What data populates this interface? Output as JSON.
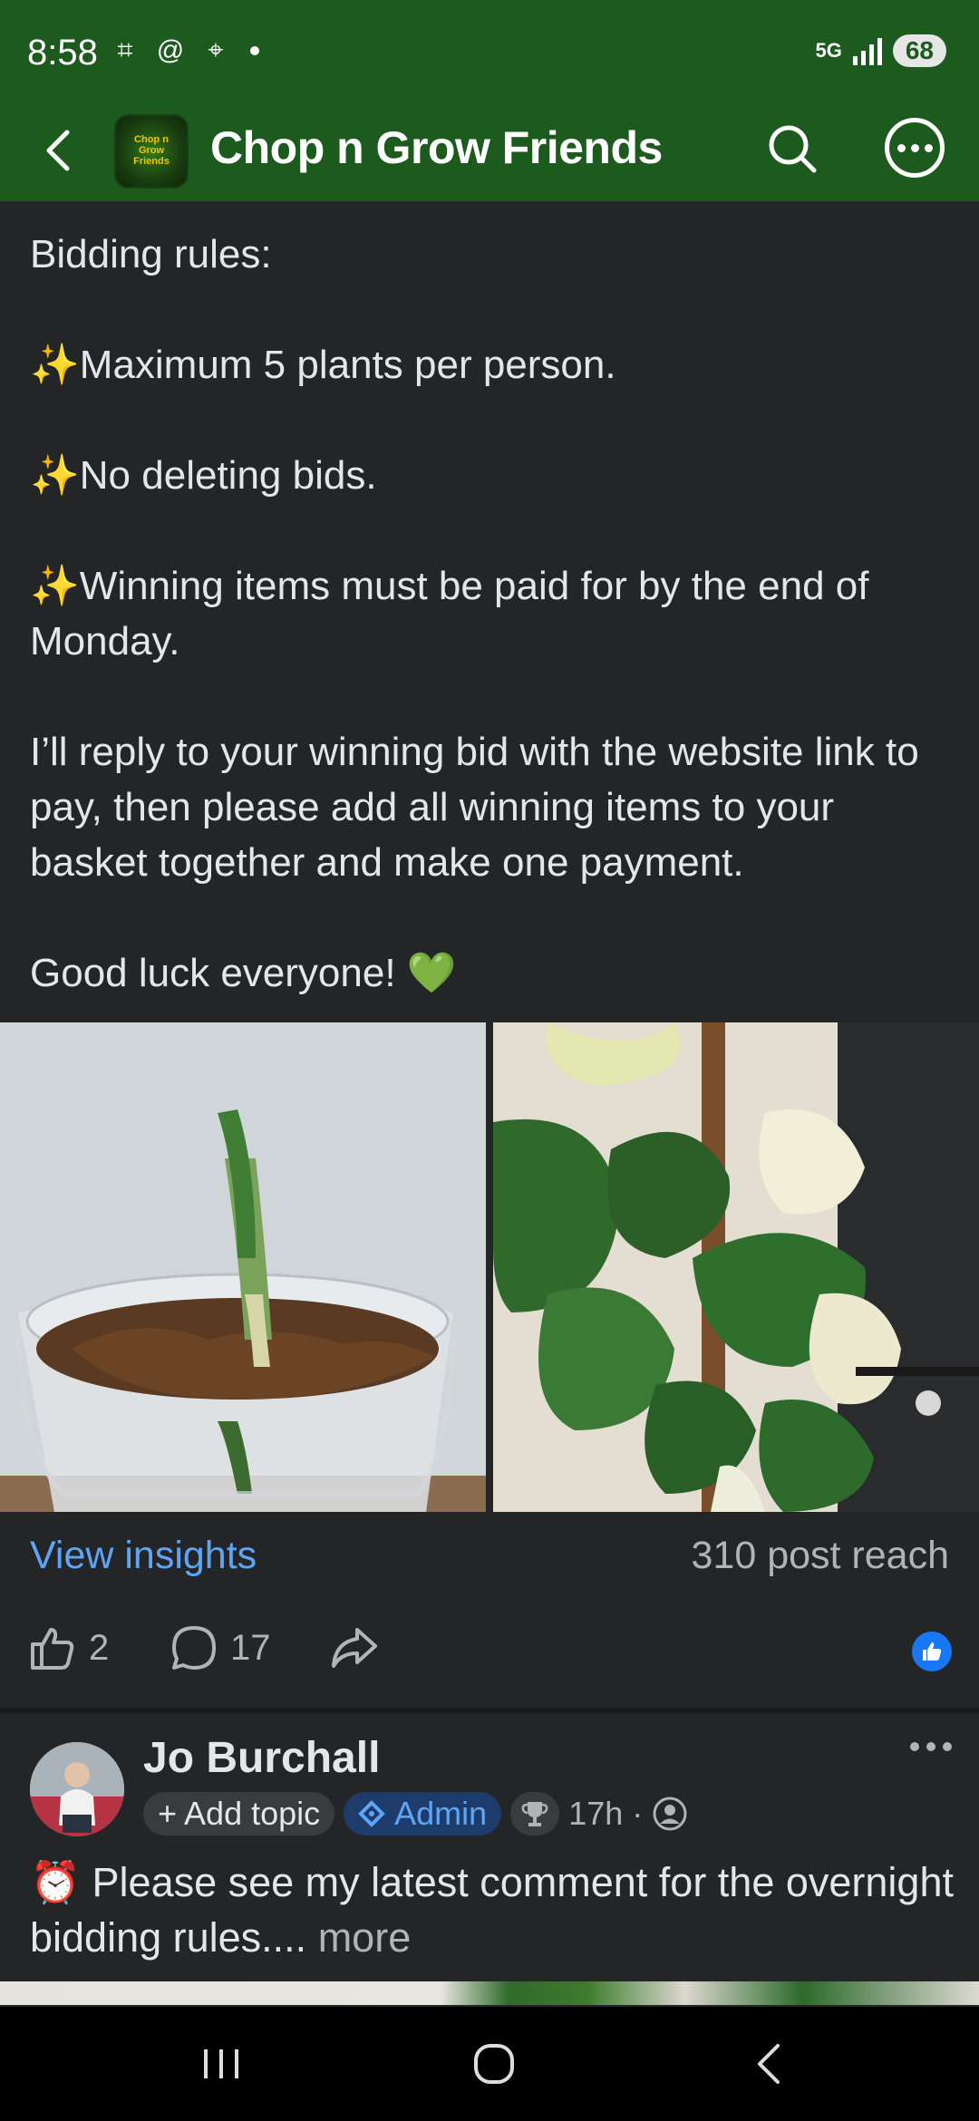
{
  "status": {
    "time": "8:58",
    "network": "5G",
    "battery": "68"
  },
  "header": {
    "title": "Chop n Grow Friends",
    "avatar_text": "Chop n Grow Friends"
  },
  "post": {
    "lines": [
      "Bidding rules:",
      "",
      "✨Maximum 5 plants per person.",
      "",
      "✨No deleting bids.",
      "",
      "✨Winning items must be paid for by the end of Monday.",
      "",
      "I’ll reply to your winning bid with the website link to pay, then please add all winning items to your basket together and make one payment.",
      "",
      "Good luck everyone! 💚"
    ],
    "insights_label": "View insights",
    "reach": "310 post reach",
    "like_count": "2",
    "comment_count": "17"
  },
  "next_post": {
    "author": "Jo Burchall",
    "add_topic": "+ Add topic",
    "admin": "Admin",
    "time": "17h ·",
    "text": "⏰ Please see my latest comment for the overnight bidding rules....",
    "more": " more"
  },
  "colors": {
    "header_bg": "#1d5a1e",
    "body_bg": "#242526",
    "link": "#5ea6f5",
    "like_badge": "#1877f2"
  }
}
